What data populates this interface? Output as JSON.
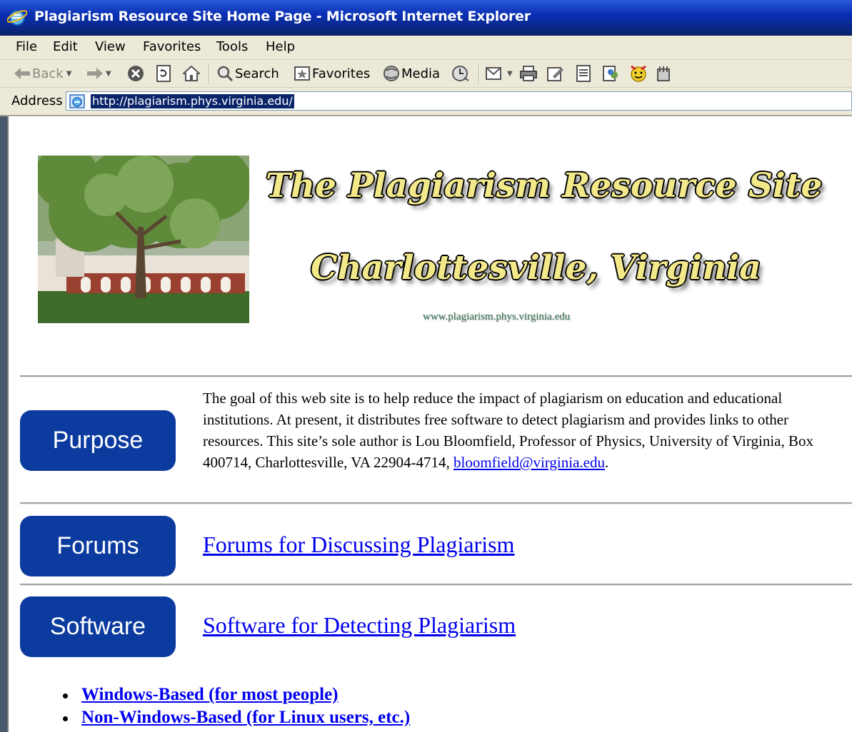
{
  "window": {
    "title": "Plagiarism Resource Site Home Page - Microsoft Internet Explorer"
  },
  "menu": [
    "File",
    "Edit",
    "View",
    "Favorites",
    "Tools",
    "Help"
  ],
  "toolbar": {
    "back_label": "Back",
    "search_label": "Search",
    "favorites_label": "Favorites",
    "media_label": "Media"
  },
  "address": {
    "label": "Address",
    "url": "http://plagiarism.phys.virginia.edu/"
  },
  "header": {
    "title": "The Plagiarism Resource Site",
    "subtitle": "Charlottesville, Virginia",
    "url": "www.plagiarism.phys.virginia.edu"
  },
  "sections": {
    "purpose": {
      "button": "Purpose",
      "text": "The goal of this web site is to help reduce the impact of plagiarism on education and educational institutions. At present, it distributes free software to detect plagiarism and provides links to other resources. This site’s sole author is Lou Bloomfield, Professor of Physics, University of Virginia, Box 400714, Charlottesville, VA 22904-4714,",
      "email": "bloomfield@virginia.edu",
      "trailing": "."
    },
    "forums": {
      "button": "Forums",
      "link": "Forums for Discussing Plagiarism"
    },
    "software": {
      "button": "Software",
      "link": "Software for Detecting Plagiarism",
      "sublinks": [
        "Windows-Based (for most people)",
        "Non-Windows-Based (for Linux users, etc.)"
      ]
    }
  }
}
